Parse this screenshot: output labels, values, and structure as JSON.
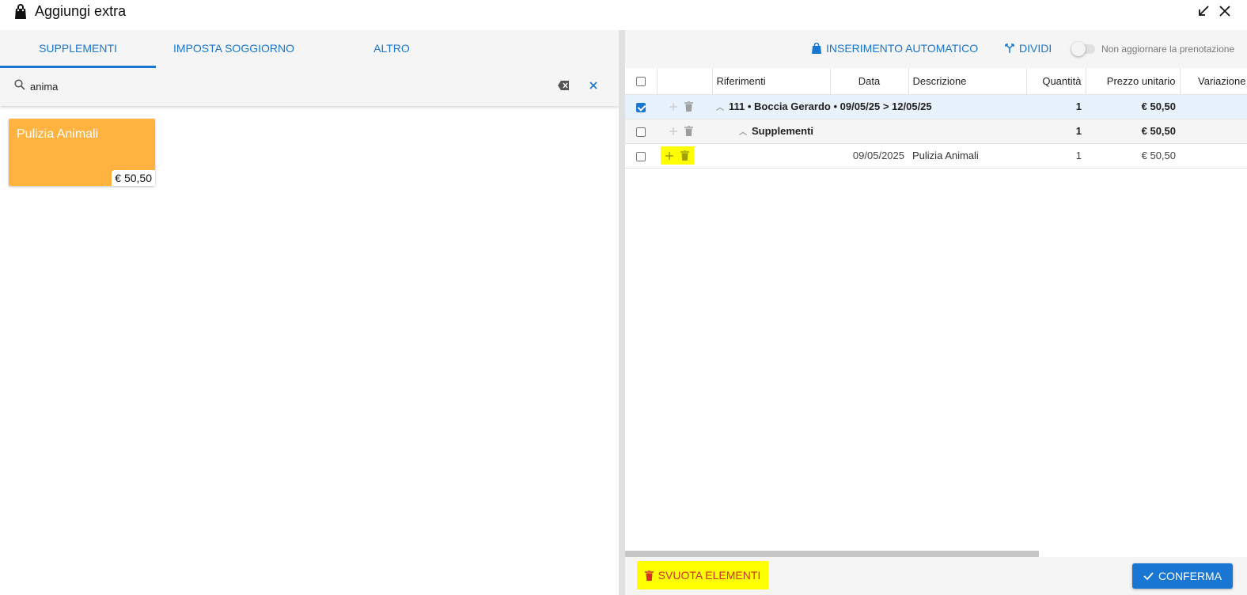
{
  "window": {
    "title": "Aggiungi extra",
    "icons": {
      "title": "shopping-bag-icon",
      "minimize": "minimize-arrow-icon",
      "close": "close-icon"
    }
  },
  "left": {
    "tabs": [
      {
        "label": "SUPPLEMENTI",
        "active": true
      },
      {
        "label": "IMPOSTA SOGGIORNO",
        "active": false
      },
      {
        "label": "ALTRO",
        "active": false
      }
    ],
    "search": {
      "value": "anima"
    },
    "cards": [
      {
        "name": "Pulizia Animali",
        "price": "€ 50,50",
        "color": "#ffb23e"
      }
    ]
  },
  "right": {
    "toolbar": {
      "auto_insert": "INSERIMENTO AUTOMATICO",
      "split": "DIVIDI",
      "toggle_label": "Non aggiornare la prenotazione",
      "toggle_on": false
    },
    "columns": [
      "Riferimenti",
      "Data",
      "Descrizione",
      "Quantità",
      "Prezzo unitario",
      "Variazione"
    ],
    "rows": [
      {
        "checked": true,
        "reference": "111 • Boccia Gerardo • 09/05/25 > 12/05/25",
        "date": "",
        "description": "",
        "quantity": "1",
        "unit_price": "€ 50,50",
        "bold": true
      },
      {
        "checked": false,
        "reference": "Supplementi",
        "date": "",
        "description": "",
        "quantity": "1",
        "unit_price": "€ 50,50",
        "bold": true
      },
      {
        "checked": false,
        "reference": "",
        "date": "09/05/2025",
        "description": "Pulizia Animali",
        "quantity": "1",
        "unit_price": "€ 50,50",
        "bold": false
      }
    ],
    "footer": {
      "empty_label": "SVUOTA ELEMENTI",
      "confirm_label": "CONFERMA"
    }
  },
  "colors": {
    "accent": "#1976d2",
    "card": "#ffb23e",
    "danger": "#d32f2f",
    "highlight": "#ffff00"
  }
}
